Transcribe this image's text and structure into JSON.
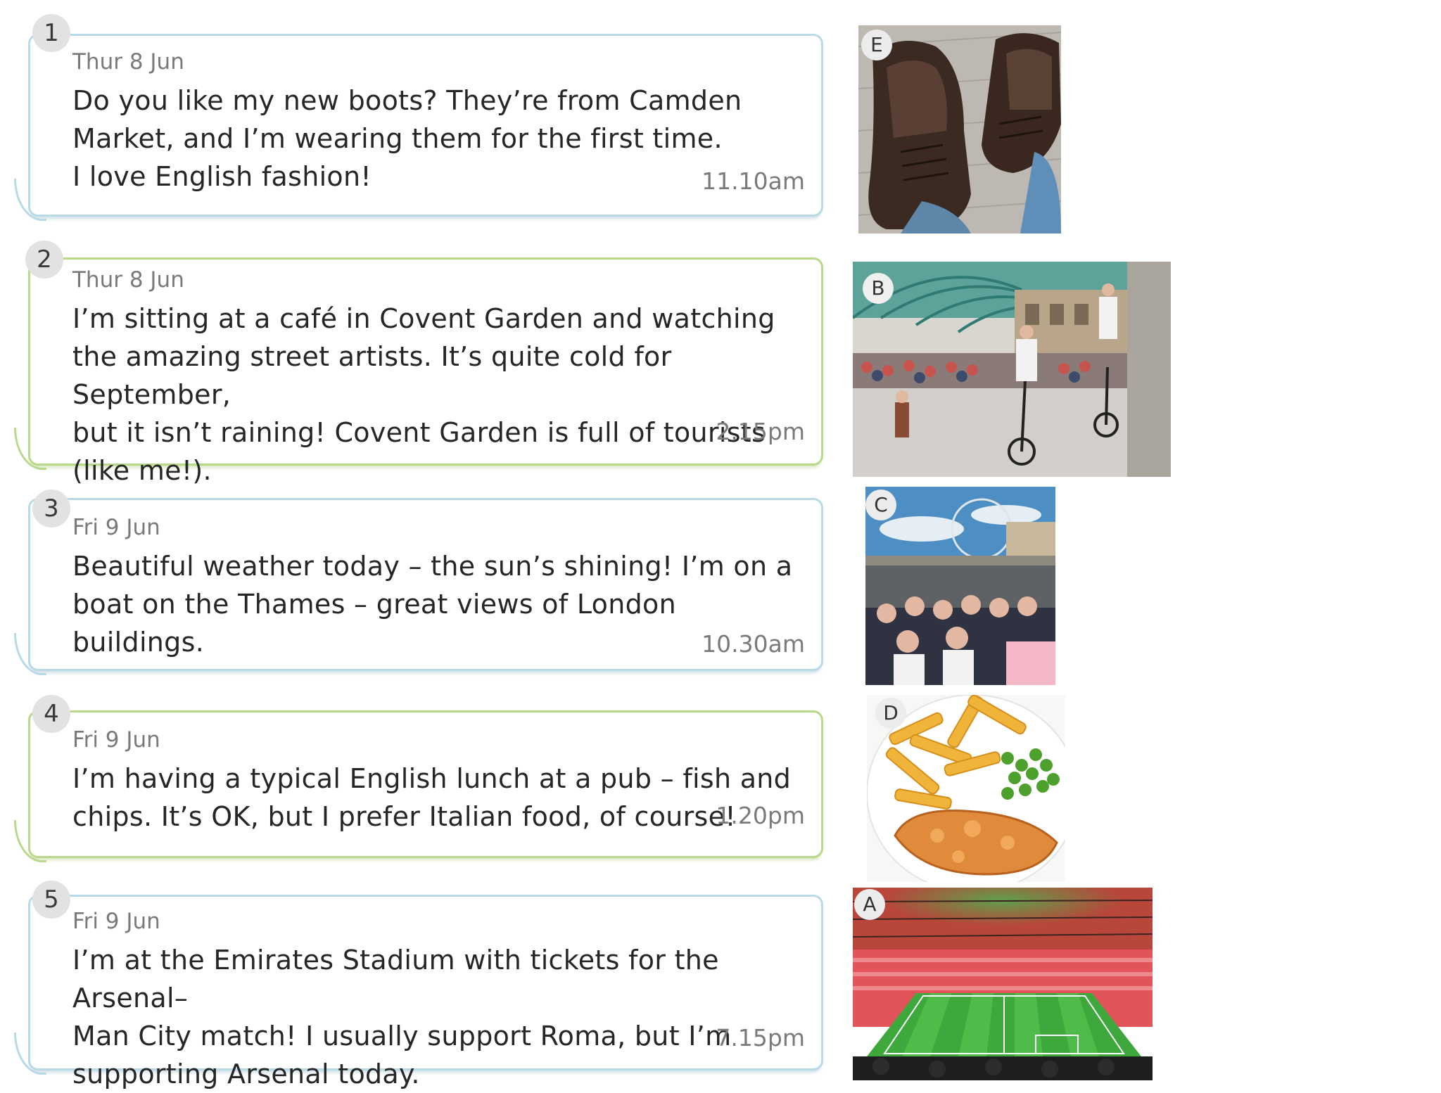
{
  "messages": [
    {
      "number": "1",
      "date": "Thur 8 Jun",
      "lines": [
        "Do you like my new boots? They’re from Camden",
        "Market, and I’m wearing them for the first time.",
        "I love English fashion!"
      ],
      "time": "11.10am",
      "color": "blue"
    },
    {
      "number": "2",
      "date": "Thur 8 Jun",
      "lines": [
        "I’m sitting at a café in Covent Garden and watching",
        "the amazing street artists. It’s quite cold for September,",
        "but it isn’t raining! Covent Garden is full of tourists",
        "(like me!)."
      ],
      "time": "2.15pm",
      "color": "green"
    },
    {
      "number": "3",
      "date": "Fri 9 Jun",
      "lines": [
        "Beautiful weather today – the sun’s shining! I’m on a",
        "boat on the Thames – great views of London buildings."
      ],
      "time": "10.30am",
      "color": "blue"
    },
    {
      "number": "4",
      "date": "Fri 9 Jun",
      "lines": [
        "I’m having a typical English lunch at a pub – fish and",
        "chips. It’s OK, but I prefer Italian food, of course!"
      ],
      "time": "1.20pm",
      "color": "green"
    },
    {
      "number": "5",
      "date": "Fri 9 Jun",
      "lines": [
        "I’m at the Emirates Stadium with tickets for the Arsenal–",
        "Man City match! I usually support Roma, but I’m",
        "supporting Arsenal today."
      ],
      "time": "7.15pm",
      "color": "blue"
    }
  ],
  "photos": [
    {
      "letter": "E",
      "subject": "boots"
    },
    {
      "letter": "B",
      "subject": "covent-garden-street-artists"
    },
    {
      "letter": "C",
      "subject": "thames-boat"
    },
    {
      "letter": "D",
      "subject": "fish-and-chips"
    },
    {
      "letter": "A",
      "subject": "emirates-stadium"
    }
  ]
}
